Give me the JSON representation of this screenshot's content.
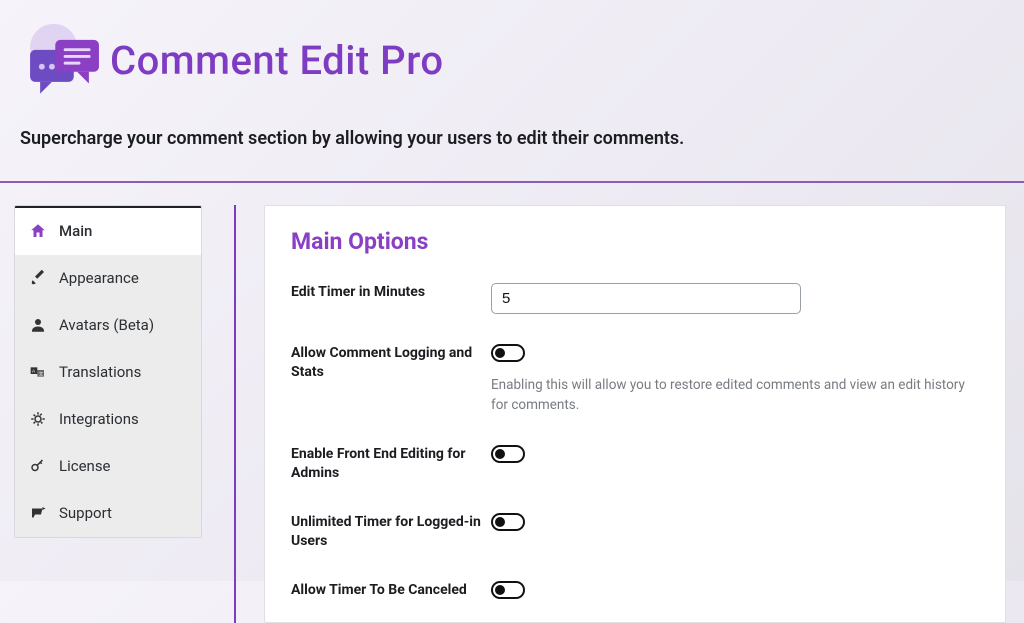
{
  "brand": {
    "title": "Comment Edit Pro",
    "tagline": "Supercharge your comment section by allowing your users to edit their comments."
  },
  "sidebar": {
    "items": [
      {
        "label": "Main"
      },
      {
        "label": "Appearance"
      },
      {
        "label": "Avatars (Beta)"
      },
      {
        "label": "Translations"
      },
      {
        "label": "Integrations"
      },
      {
        "label": "License"
      },
      {
        "label": "Support"
      }
    ]
  },
  "panel": {
    "title": "Main Options",
    "options": {
      "edit_timer": {
        "label": "Edit Timer in Minutes",
        "value": "5"
      },
      "logging": {
        "label": "Allow Comment Logging and Stats",
        "help": "Enabling this will allow you to restore edited comments and view an edit history for comments.",
        "enabled": false
      },
      "frontend_edit": {
        "label": "Enable Front End Editing for Admins",
        "enabled": false
      },
      "unlimited_timer": {
        "label": "Unlimited Timer for Logged-in Users",
        "enabled": false
      },
      "timer_cancel": {
        "label": "Allow Timer To Be Canceled",
        "enabled": false
      }
    }
  }
}
